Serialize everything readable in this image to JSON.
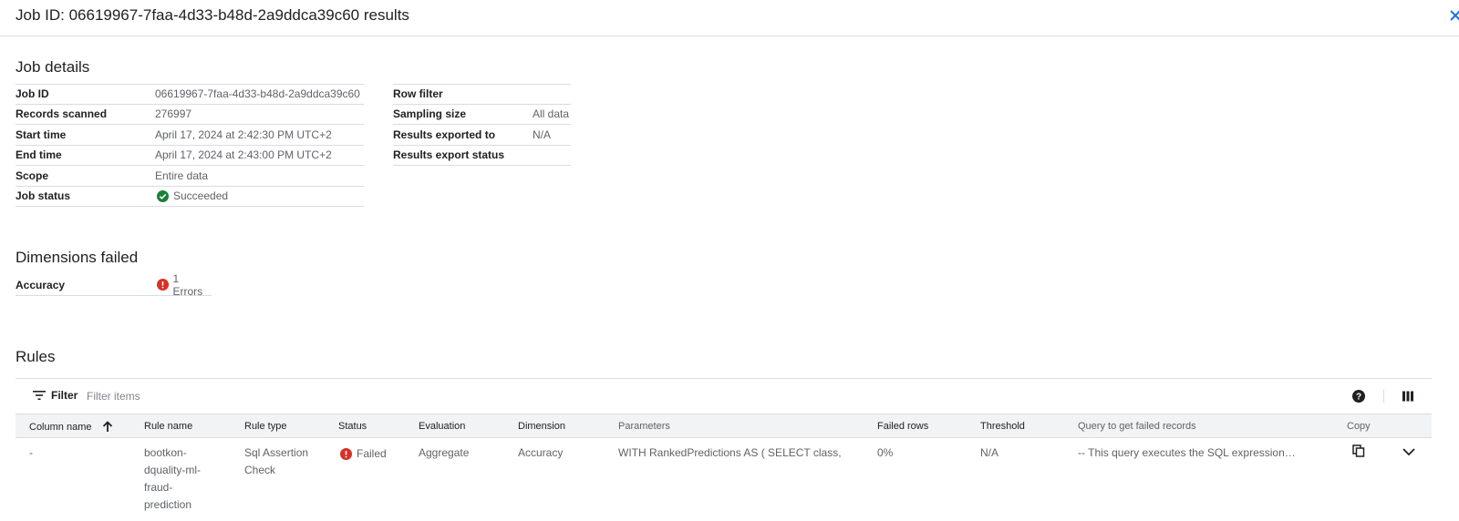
{
  "header": {
    "title": "Job ID: 06619967-7faa-4d33-b48d-2a9ddca39c60 results"
  },
  "job_details": {
    "title": "Job details",
    "left": [
      {
        "key": "Job ID",
        "value": "06619967-7faa-4d33-b48d-2a9ddca39c60"
      },
      {
        "key": "Records scanned",
        "value": "276997"
      },
      {
        "key": "Start time",
        "value": "April 17, 2024 at 2:42:30 PM UTC+2"
      },
      {
        "key": "End time",
        "value": "April 17, 2024 at 2:43:00 PM UTC+2"
      },
      {
        "key": "Scope",
        "value": "Entire data"
      },
      {
        "key": "Job status",
        "value": "Succeeded",
        "icon": "check-circle-icon"
      }
    ],
    "right": [
      {
        "key": "Row filter",
        "value": ""
      },
      {
        "key": "Sampling size",
        "value": "All data"
      },
      {
        "key": "Results exported to",
        "value": "N/A"
      },
      {
        "key": "Results export status",
        "value": ""
      }
    ]
  },
  "dimensions_failed": {
    "title": "Dimensions failed",
    "rows": [
      {
        "key": "Accuracy",
        "value": "1 Errors",
        "icon": "error-icon"
      }
    ]
  },
  "rules": {
    "title": "Rules",
    "filter_label": "Filter",
    "filter_placeholder": "Filter items",
    "columns": [
      "Column name",
      "Rule name",
      "Rule type",
      "Status",
      "Evaluation",
      "Dimension",
      "Parameters",
      "Failed rows",
      "Threshold",
      "Query to get failed records",
      "Copy"
    ],
    "sort_column": "Column name",
    "rows": [
      {
        "column_name": "-",
        "rule_name_lines": [
          "bootkon-",
          "dquality-ml-",
          "fraud-",
          "prediction"
        ],
        "rule_type_lines": [
          "Sql Assertion",
          "Check"
        ],
        "status": "Failed",
        "evaluation": "Aggregate",
        "dimension": "Accuracy",
        "parameters": "WITH RankedPredictions AS ( SELECT class,",
        "failed_rows": "0%",
        "threshold": "N/A",
        "query": "-- This query executes the SQL expression…"
      }
    ]
  },
  "colors": {
    "success": "#188038",
    "error": "#d93025",
    "link": "#1a73e8",
    "border": "#dadce0",
    "header_bg": "#f1f3f4"
  }
}
